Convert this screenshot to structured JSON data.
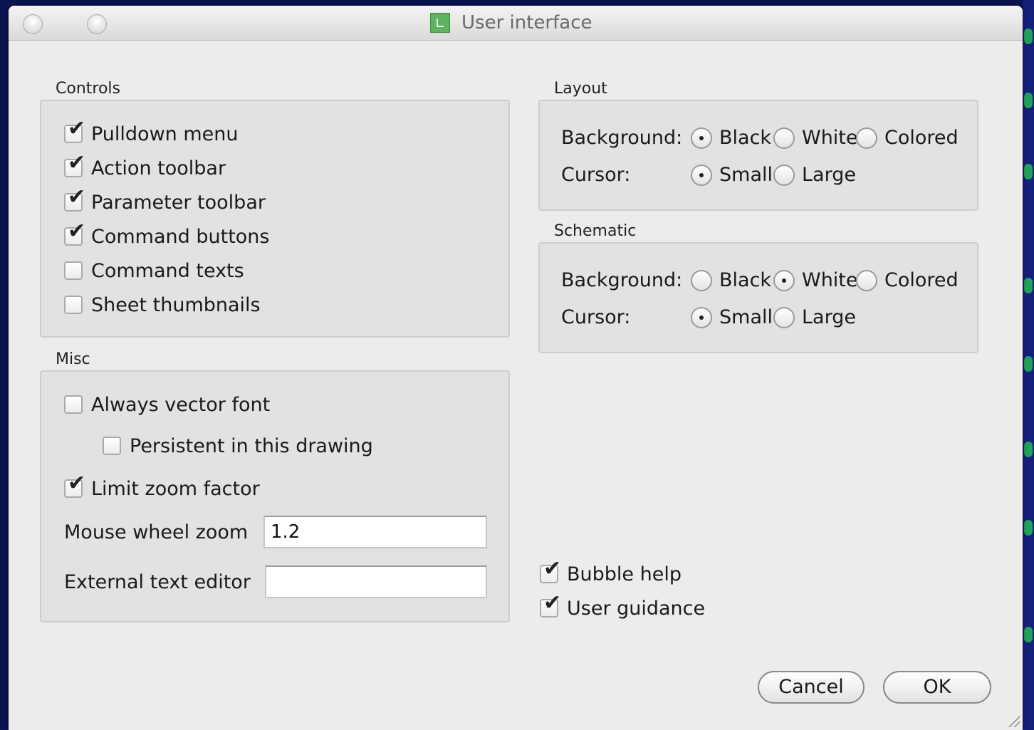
{
  "window": {
    "title": "User interface"
  },
  "controls": {
    "label": "Controls",
    "items": [
      {
        "label": "Pulldown menu",
        "checked": true
      },
      {
        "label": "Action toolbar",
        "checked": true
      },
      {
        "label": "Parameter toolbar",
        "checked": true
      },
      {
        "label": "Command buttons",
        "checked": true
      },
      {
        "label": "Command texts",
        "checked": false
      },
      {
        "label": "Sheet thumbnails",
        "checked": false
      }
    ]
  },
  "misc": {
    "label": "Misc",
    "always_vector_font": {
      "label": "Always vector font",
      "checked": false
    },
    "persistent": {
      "label": "Persistent in this drawing",
      "checked": false
    },
    "limit_zoom": {
      "label": "Limit zoom factor",
      "checked": true
    },
    "mouse_wheel_zoom": {
      "label": "Mouse wheel zoom",
      "value": "1.2"
    },
    "external_editor": {
      "label": "External text editor",
      "value": ""
    }
  },
  "layout": {
    "label": "Layout",
    "background": {
      "label": "Background:",
      "options": [
        "Black",
        "White",
        "Colored"
      ],
      "selected": "Black"
    },
    "cursor": {
      "label": "Cursor:",
      "options": [
        "Small",
        "Large"
      ],
      "selected": "Small"
    }
  },
  "schematic": {
    "label": "Schematic",
    "background": {
      "label": "Background:",
      "options": [
        "Black",
        "White",
        "Colored"
      ],
      "selected": "White"
    },
    "cursor": {
      "label": "Cursor:",
      "options": [
        "Small",
        "Large"
      ],
      "selected": "Small"
    }
  },
  "bubble_help": {
    "label": "Bubble help",
    "checked": true
  },
  "user_guidance": {
    "label": "User guidance",
    "checked": true
  },
  "buttons": {
    "cancel": "Cancel",
    "ok": "OK"
  },
  "colors": {
    "window_bg": "#ececec",
    "panel_bg": "#e2e2e2",
    "desktop_bg": "#0a1450"
  }
}
